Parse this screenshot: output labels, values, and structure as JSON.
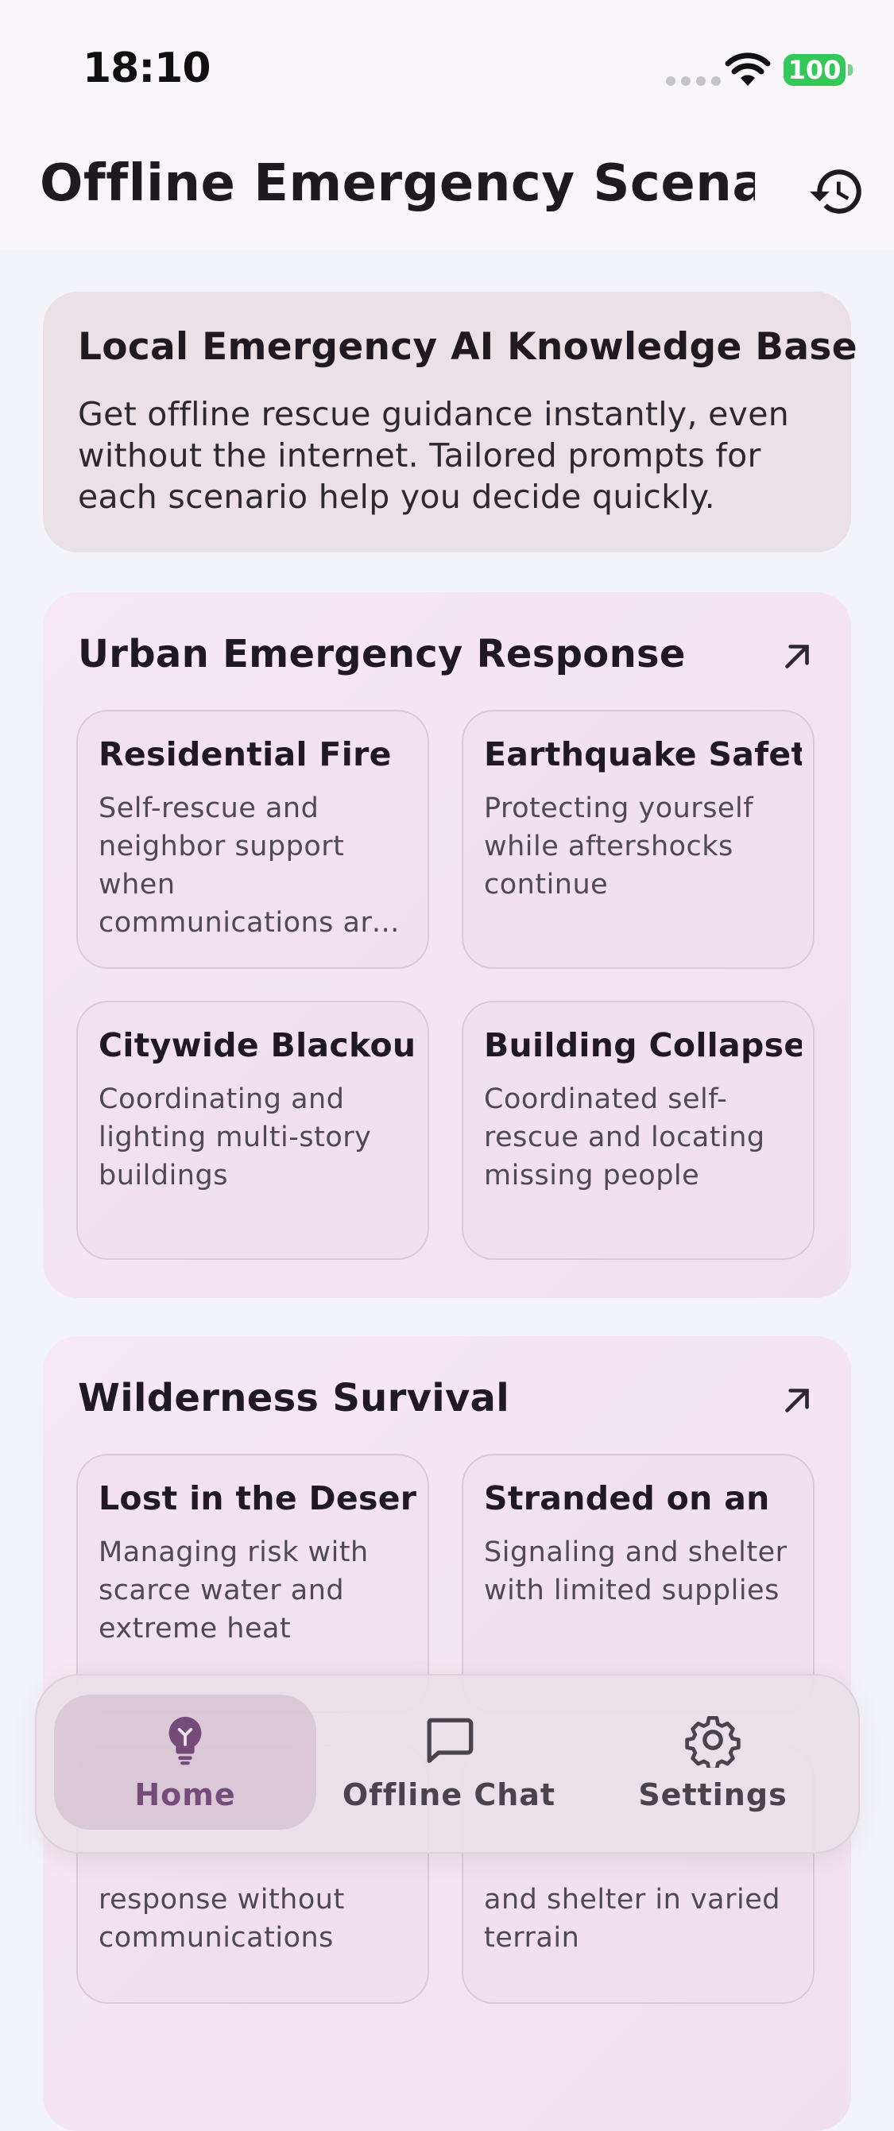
{
  "status_bar": {
    "time": "18:10",
    "battery": "100"
  },
  "app_bar": {
    "title": "Offline Emergency Scena..."
  },
  "intro": {
    "title": "Local Emergency AI Knowledge Base",
    "description": "Get offline rescue guidance instantly, even without the internet. Tailored prompts for each scenario help you decide quickly."
  },
  "sections": [
    {
      "title": "Urban Emergency Response",
      "tiles": [
        {
          "title": "Residential Fire",
          "description": "Self-rescue and neighbor support when communications are down"
        },
        {
          "title": "Earthquake Safety",
          "description": "Protecting yourself while aftershocks continue"
        },
        {
          "title": "Citywide Blackout",
          "description": "Coordinating and lighting multi-story buildings"
        },
        {
          "title": "Building Collapse",
          "description": "Coordinated self-rescue and locating missing people"
        }
      ]
    },
    {
      "title": "Wilderness Survival",
      "tiles": [
        {
          "title": "Lost in the Desert",
          "description": "Managing risk with scarce water and extreme heat"
        },
        {
          "title": "Stranded on an",
          "description": "Signaling and shelter with limited supplies"
        },
        {
          "title": "",
          "description": "response without communications"
        },
        {
          "title": "",
          "description": "and shelter in varied terrain"
        }
      ]
    }
  ],
  "nav": {
    "items": [
      {
        "label": "Home",
        "icon": "lightbulb-icon",
        "active": true
      },
      {
        "label": "Offline Chat",
        "icon": "chat-bubble-icon",
        "active": false
      },
      {
        "label": "Settings",
        "icon": "gear-icon",
        "active": false
      }
    ]
  },
  "colors": {
    "accent": "#754b7a",
    "card": "#f3e4ef",
    "tile_border": "#dcc8d6",
    "intro_card": "#eae0e6",
    "battery": "#34c759"
  }
}
